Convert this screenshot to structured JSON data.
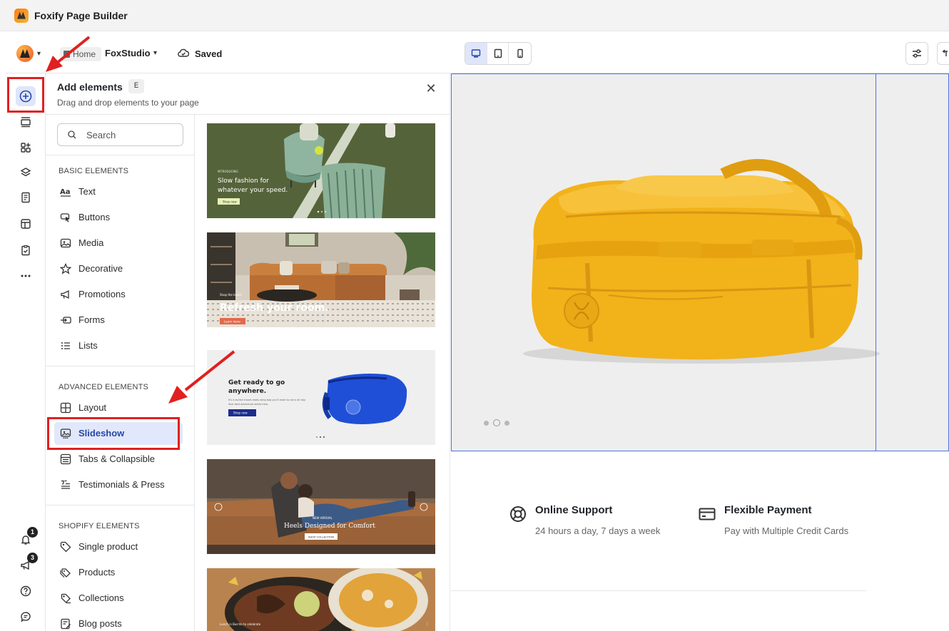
{
  "window": {
    "title": "Foxify Page Builder"
  },
  "toolbar": {
    "breadcrumb_home": "Home",
    "store_name": "FoxStudio",
    "save_status": "Saved",
    "devices": [
      "desktop-icon",
      "tablet-icon",
      "mobile-icon"
    ],
    "active_device": "desktop"
  },
  "rail": {
    "items": [
      "add-elements-icon",
      "sections-icon",
      "apps-icon",
      "layers-icon",
      "pages-icon",
      "templates-icon",
      "checklist-icon",
      "more-icon"
    ],
    "notifications_count": "1",
    "announcements_count": "3"
  },
  "panel": {
    "title": "Add elements",
    "shortcut": "E",
    "subtitle": "Drag and drop elements to your page",
    "search_placeholder": "Search",
    "groups": [
      {
        "label": "BASIC ELEMENTS",
        "items": [
          "Text",
          "Buttons",
          "Media",
          "Decorative",
          "Promotions",
          "Forms",
          "Lists"
        ]
      },
      {
        "label": "ADVANCED ELEMENTS",
        "items": [
          "Layout",
          "Slideshow",
          "Tabs & Collapsible",
          "Testimonials & Press"
        ]
      },
      {
        "label": "SHOPIFY ELEMENTS",
        "items": [
          "Single product",
          "Products",
          "Collections",
          "Blog posts"
        ]
      }
    ],
    "active_item": "Slideshow",
    "thumbnails": [
      {
        "tag": "INTRODUCING",
        "heading": "Slow fashion for whatever your speed.",
        "button": "Shop now"
      },
      {
        "tag": "Shop the looks!",
        "heading": "Refresh your room.",
        "button": "Learn more"
      },
      {
        "heading": "Get ready to go anywhere.",
        "body": "It's a stylish travel-ready sling bag you'll want to carry all day. Your best adventure starts here.",
        "button": "Shop now"
      },
      {
        "tag": "NEW ARRIVAL",
        "heading": "Heels Designed for Comfort",
        "button": "SHOP COLLECTION"
      },
      {
        "heading": "Lunch in Burrito to celebrate"
      }
    ]
  },
  "canvas": {
    "slider_dots": 3,
    "active_dot": 2,
    "features": [
      {
        "icon": "lifebuoy-icon",
        "title": "Online Support",
        "desc": "24 hours a day, 7 days a week"
      },
      {
        "icon": "credit-card-icon",
        "title": "Flexible Payment",
        "desc": "Pay with Multiple Credit Cards"
      }
    ]
  },
  "colors": {
    "accent": "#2847a8",
    "active_bg": "#dfe6fb",
    "annotation": "#e02020",
    "bag": "#f2b21a",
    "selection": "#4a73d8"
  }
}
